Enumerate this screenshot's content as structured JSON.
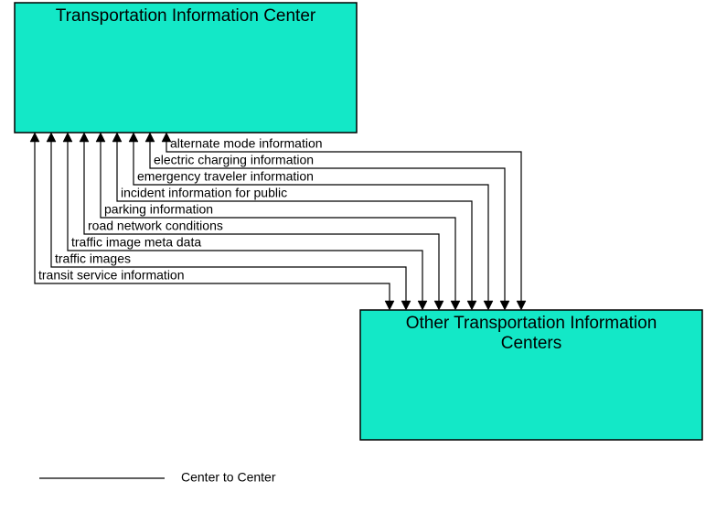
{
  "boxes": {
    "top": {
      "title": "Transportation Information Center",
      "fill": "#13e8c7"
    },
    "bottom": {
      "title_line1": "Other Transportation Information",
      "title_line2": "Centers",
      "fill": "#13e8c7"
    }
  },
  "flows": [
    "transit service information",
    "traffic images",
    "traffic image meta data",
    "road network conditions",
    "parking information",
    "incident information for public",
    "emergency traveler information",
    "electric charging information",
    "alternate mode information"
  ],
  "legend": {
    "label": "Center to Center"
  }
}
